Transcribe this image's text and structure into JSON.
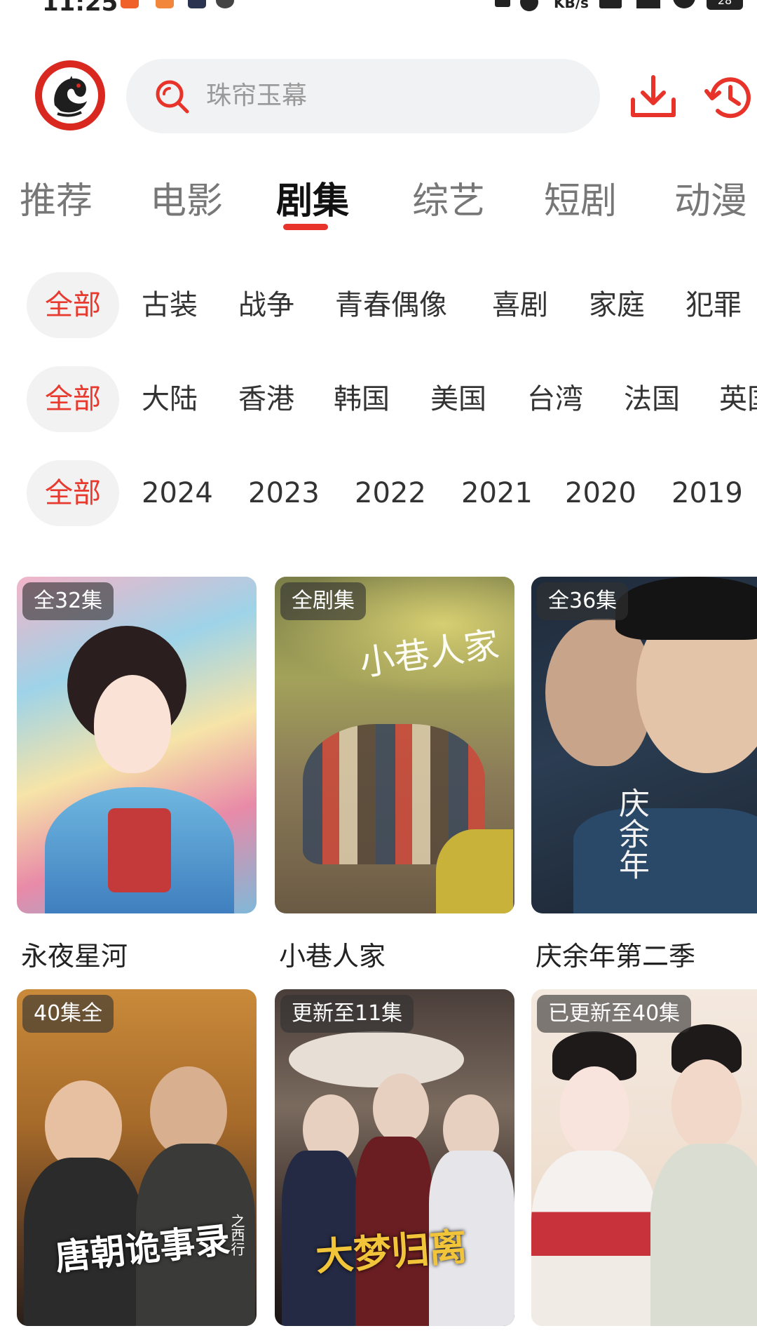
{
  "status_bar": {
    "time": "11:25",
    "speed_unit": "KB/s",
    "battery": "28"
  },
  "header": {
    "search_placeholder": "珠帘玉幕"
  },
  "tabs": [
    {
      "label": "推荐"
    },
    {
      "label": "电影"
    },
    {
      "label": "剧集"
    },
    {
      "label": "综艺"
    },
    {
      "label": "短剧"
    },
    {
      "label": "动漫"
    }
  ],
  "active_tab": "剧集",
  "filters": {
    "genre": [
      "全部",
      "古装",
      "战争",
      "青春偶像",
      "喜剧",
      "家庭",
      "犯罪"
    ],
    "region": [
      "全部",
      "大陆",
      "香港",
      "韩国",
      "美国",
      "台湾",
      "法国",
      "英国"
    ],
    "year": [
      "全部",
      "2024",
      "2023",
      "2022",
      "2021",
      "2020",
      "2019"
    ]
  },
  "shows": [
    {
      "title": "永夜星河",
      "badge": "全32集"
    },
    {
      "title": "小巷人家",
      "badge": "全剧集"
    },
    {
      "title": "庆余年第二季",
      "badge": "全36集"
    },
    {
      "title": "",
      "badge": "40集全"
    },
    {
      "title": "",
      "badge": "更新至11集"
    },
    {
      "title": "",
      "badge": "已更新至40集"
    }
  ],
  "poster_art_text": [
    "小巷人家",
    "庆余年",
    "唐朝诡事录",
    "之西行",
    "大梦归离"
  ],
  "colors": {
    "accent": "#e8332a",
    "chip_bg": "#f2f2f2",
    "search_bg": "#f1f2f3"
  },
  "icons": [
    "search-icon",
    "download-icon",
    "history-icon",
    "dragon-logo-icon"
  ]
}
